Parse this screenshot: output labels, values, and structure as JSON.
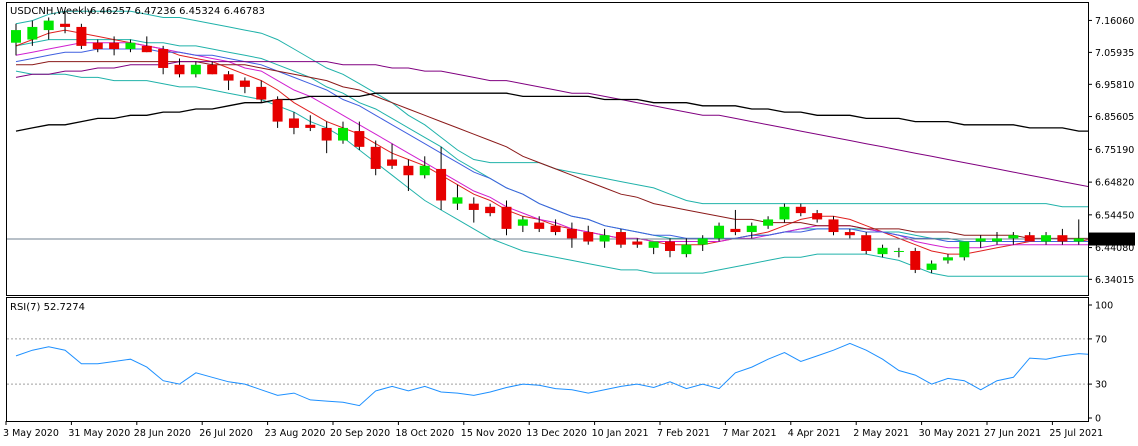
{
  "colors": {
    "background": "#ffffff",
    "frame": "#000000",
    "bull": "#00e600",
    "bear": "#e60000",
    "wick": "#000000",
    "bollinger": "#20b2aa",
    "ma_fast": "#e0201f",
    "ma_magenta": "#d020d0",
    "ma_blue": "#4060e0",
    "ma_dark_red": "#8b1a1a",
    "ma_purple": "#800080",
    "ma_black": "#000000",
    "rsi": "#1e90ff",
    "price_line": "#708090",
    "price_tag_bg": "#000000",
    "price_tag_fg": "#ffffff",
    "level_line": "#a0a0a0"
  },
  "chart_data": {
    "type": "candlestick",
    "title": "USDCNH,Weekly",
    "ohlc_header": "6.46257 6.47236 6.45324 6.46783",
    "last_price_label": "6.46783",
    "last_price": 6.46783,
    "ylim": [
      6.3,
      7.2
    ],
    "y_ticks": [
      "7.16060",
      "7.05935",
      "6.95810",
      "6.85605",
      "6.75190",
      "6.64820",
      "6.54450",
      "6.44080",
      "6.34015"
    ],
    "y_tick_values": [
      7.1606,
      7.05935,
      6.9581,
      6.85605,
      6.7519,
      6.6482,
      6.5445,
      6.4408,
      6.34015
    ],
    "x_labels": [
      "3 May 2020",
      "31 May 2020",
      "28 Jun 2020",
      "26 Jul 2020",
      "23 Aug 2020",
      "20 Sep 2020",
      "18 Oct 2020",
      "15 Nov 2020",
      "13 Dec 2020",
      "10 Jan 2021",
      "7 Feb 2021",
      "7 Mar 2021",
      "4 Apr 2021",
      "2 May 2021",
      "30 May 2021",
      "27 Jun 2021",
      "25 Jul 2021"
    ],
    "x_label_weeks": [
      0,
      4,
      8,
      12,
      16,
      20,
      24,
      28,
      32,
      36,
      40,
      44,
      48,
      52,
      56,
      60,
      64
    ],
    "candles": [
      {
        "o": 7.09,
        "h": 7.15,
        "l": 7.05,
        "c": 7.13
      },
      {
        "o": 7.1,
        "h": 7.16,
        "l": 7.08,
        "c": 7.14
      },
      {
        "o": 7.13,
        "h": 7.17,
        "l": 7.1,
        "c": 7.16
      },
      {
        "o": 7.15,
        "h": 7.19,
        "l": 7.12,
        "c": 7.14
      },
      {
        "o": 7.14,
        "h": 7.15,
        "l": 7.07,
        "c": 7.08
      },
      {
        "o": 7.09,
        "h": 7.1,
        "l": 7.06,
        "c": 7.07
      },
      {
        "o": 7.09,
        "h": 7.11,
        "l": 7.05,
        "c": 7.07
      },
      {
        "o": 7.07,
        "h": 7.1,
        "l": 7.06,
        "c": 7.09
      },
      {
        "o": 7.08,
        "h": 7.11,
        "l": 7.06,
        "c": 7.06
      },
      {
        "o": 7.07,
        "h": 7.08,
        "l": 6.99,
        "c": 7.01
      },
      {
        "o": 7.02,
        "h": 7.04,
        "l": 6.98,
        "c": 6.99
      },
      {
        "o": 6.99,
        "h": 7.03,
        "l": 6.98,
        "c": 7.02
      },
      {
        "o": 7.02,
        "h": 7.03,
        "l": 6.99,
        "c": 6.99
      },
      {
        "o": 6.99,
        "h": 7.0,
        "l": 6.94,
        "c": 6.97
      },
      {
        "o": 6.97,
        "h": 6.98,
        "l": 6.93,
        "c": 6.95
      },
      {
        "o": 6.95,
        "h": 6.97,
        "l": 6.9,
        "c": 6.91
      },
      {
        "o": 6.91,
        "h": 6.92,
        "l": 6.82,
        "c": 6.84
      },
      {
        "o": 6.85,
        "h": 6.87,
        "l": 6.8,
        "c": 6.82
      },
      {
        "o": 6.83,
        "h": 6.86,
        "l": 6.81,
        "c": 6.82
      },
      {
        "o": 6.82,
        "h": 6.84,
        "l": 6.74,
        "c": 6.78
      },
      {
        "o": 6.78,
        "h": 6.84,
        "l": 6.77,
        "c": 6.82
      },
      {
        "o": 6.81,
        "h": 6.84,
        "l": 6.75,
        "c": 6.76
      },
      {
        "o": 6.76,
        "h": 6.78,
        "l": 6.67,
        "c": 6.69
      },
      {
        "o": 6.72,
        "h": 6.77,
        "l": 6.69,
        "c": 6.7
      },
      {
        "o": 6.7,
        "h": 6.72,
        "l": 6.62,
        "c": 6.67
      },
      {
        "o": 6.67,
        "h": 6.73,
        "l": 6.66,
        "c": 6.7
      },
      {
        "o": 6.69,
        "h": 6.76,
        "l": 6.56,
        "c": 6.59
      },
      {
        "o": 6.58,
        "h": 6.64,
        "l": 6.56,
        "c": 6.6
      },
      {
        "o": 6.58,
        "h": 6.6,
        "l": 6.52,
        "c": 6.56
      },
      {
        "o": 6.57,
        "h": 6.58,
        "l": 6.54,
        "c": 6.55
      },
      {
        "o": 6.57,
        "h": 6.59,
        "l": 6.48,
        "c": 6.5
      },
      {
        "o": 6.51,
        "h": 6.54,
        "l": 6.49,
        "c": 6.53
      },
      {
        "o": 6.52,
        "h": 6.54,
        "l": 6.49,
        "c": 6.5
      },
      {
        "o": 6.51,
        "h": 6.53,
        "l": 6.48,
        "c": 6.49
      },
      {
        "o": 6.5,
        "h": 6.52,
        "l": 6.44,
        "c": 6.47
      },
      {
        "o": 6.49,
        "h": 6.51,
        "l": 6.45,
        "c": 6.46
      },
      {
        "o": 6.46,
        "h": 6.5,
        "l": 6.44,
        "c": 6.48
      },
      {
        "o": 6.49,
        "h": 6.5,
        "l": 6.44,
        "c": 6.45
      },
      {
        "o": 6.46,
        "h": 6.47,
        "l": 6.44,
        "c": 6.45
      },
      {
        "o": 6.44,
        "h": 6.46,
        "l": 6.42,
        "c": 6.46
      },
      {
        "o": 6.46,
        "h": 6.47,
        "l": 6.41,
        "c": 6.43
      },
      {
        "o": 6.42,
        "h": 6.47,
        "l": 6.41,
        "c": 6.45
      },
      {
        "o": 6.45,
        "h": 6.48,
        "l": 6.43,
        "c": 6.47
      },
      {
        "o": 6.47,
        "h": 6.52,
        "l": 6.46,
        "c": 6.51
      },
      {
        "o": 6.5,
        "h": 6.56,
        "l": 6.48,
        "c": 6.49
      },
      {
        "o": 6.49,
        "h": 6.52,
        "l": 6.47,
        "c": 6.51
      },
      {
        "o": 6.51,
        "h": 6.54,
        "l": 6.5,
        "c": 6.53
      },
      {
        "o": 6.53,
        "h": 6.58,
        "l": 6.52,
        "c": 6.57
      },
      {
        "o": 6.57,
        "h": 6.58,
        "l": 6.54,
        "c": 6.55
      },
      {
        "o": 6.55,
        "h": 6.56,
        "l": 6.52,
        "c": 6.53
      },
      {
        "o": 6.53,
        "h": 6.54,
        "l": 6.48,
        "c": 6.49
      },
      {
        "o": 6.49,
        "h": 6.5,
        "l": 6.47,
        "c": 6.48
      },
      {
        "o": 6.48,
        "h": 6.49,
        "l": 6.42,
        "c": 6.43
      },
      {
        "o": 6.42,
        "h": 6.45,
        "l": 6.41,
        "c": 6.44
      },
      {
        "o": 6.43,
        "h": 6.44,
        "l": 6.41,
        "c": 6.43
      },
      {
        "o": 6.43,
        "h": 6.44,
        "l": 6.36,
        "c": 6.37
      },
      {
        "o": 6.37,
        "h": 6.4,
        "l": 6.36,
        "c": 6.39
      },
      {
        "o": 6.4,
        "h": 6.42,
        "l": 6.39,
        "c": 6.41
      },
      {
        "o": 6.41,
        "h": 6.46,
        "l": 6.4,
        "c": 6.46
      },
      {
        "o": 6.46,
        "h": 6.48,
        "l": 6.44,
        "c": 6.47
      },
      {
        "o": 6.46,
        "h": 6.49,
        "l": 6.45,
        "c": 6.47
      },
      {
        "o": 6.47,
        "h": 6.49,
        "l": 6.45,
        "c": 6.48
      },
      {
        "o": 6.48,
        "h": 6.49,
        "l": 6.46,
        "c": 6.46
      },
      {
        "o": 6.46,
        "h": 6.49,
        "l": 6.45,
        "c": 6.48
      },
      {
        "o": 6.48,
        "h": 6.5,
        "l": 6.45,
        "c": 6.46
      },
      {
        "o": 6.46,
        "h": 6.53,
        "l": 6.45,
        "c": 6.47
      },
      {
        "o": 6.46,
        "h": 6.47,
        "l": 6.45,
        "c": 6.47
      }
    ],
    "bollinger": {
      "upper": [
        7.15,
        7.16,
        7.18,
        7.19,
        7.19,
        7.19,
        7.19,
        7.19,
        7.18,
        7.17,
        7.17,
        7.16,
        7.15,
        7.14,
        7.13,
        7.12,
        7.1,
        7.07,
        7.04,
        7.01,
        6.99,
        6.96,
        6.93,
        6.9,
        6.86,
        6.83,
        6.79,
        6.75,
        6.72,
        6.71,
        6.71,
        6.71,
        6.71,
        6.69,
        6.68,
        6.67,
        6.66,
        6.65,
        6.64,
        6.63,
        6.61,
        6.59,
        6.58,
        6.58,
        6.58,
        6.58,
        6.58,
        6.58,
        6.58,
        6.58,
        6.58,
        6.58,
        6.58,
        6.58,
        6.58,
        6.58,
        6.58,
        6.58,
        6.58,
        6.58,
        6.58,
        6.58,
        6.58,
        6.58,
        6.57,
        6.57,
        6.57
      ],
      "middle": [
        7.08,
        7.09,
        7.1,
        7.1,
        7.1,
        7.1,
        7.1,
        7.1,
        7.09,
        7.09,
        7.08,
        7.08,
        7.07,
        7.06,
        7.05,
        7.04,
        7.02,
        7.0,
        6.98,
        6.95,
        6.93,
        6.9,
        6.88,
        6.85,
        6.82,
        6.79,
        6.76,
        6.72,
        6.69,
        6.66,
        6.63,
        6.61,
        6.58,
        6.56,
        6.54,
        6.53,
        6.51,
        6.5,
        6.49,
        6.48,
        6.47,
        6.47,
        6.47,
        6.47,
        6.47,
        6.48,
        6.48,
        6.49,
        6.5,
        6.5,
        6.5,
        6.5,
        6.5,
        6.49,
        6.49,
        6.48,
        6.47,
        6.47,
        6.46,
        6.46,
        6.46,
        6.46,
        6.46,
        6.46,
        6.46,
        6.46,
        6.46
      ],
      "lower": [
        7.0,
        6.99,
        6.99,
        6.99,
        6.98,
        6.98,
        6.97,
        6.97,
        6.97,
        6.96,
        6.95,
        6.95,
        6.94,
        6.93,
        6.92,
        6.91,
        6.89,
        6.87,
        6.84,
        6.82,
        6.79,
        6.75,
        6.71,
        6.67,
        6.63,
        6.59,
        6.56,
        6.53,
        6.5,
        6.47,
        6.45,
        6.43,
        6.42,
        6.41,
        6.4,
        6.39,
        6.38,
        6.37,
        6.37,
        6.36,
        6.36,
        6.36,
        6.36,
        6.37,
        6.38,
        6.39,
        6.4,
        6.41,
        6.41,
        6.42,
        6.42,
        6.42,
        6.42,
        6.41,
        6.4,
        6.38,
        6.36,
        6.35,
        6.35,
        6.35,
        6.35,
        6.35,
        6.35,
        6.35,
        6.35,
        6.35,
        6.35
      ]
    },
    "moving_averages": [
      {
        "color_key": "ma_fast",
        "values": [
          7.08,
          7.1,
          7.12,
          7.13,
          7.12,
          7.11,
          7.1,
          7.09,
          7.08,
          7.07,
          7.05,
          7.04,
          7.03,
          7.01,
          6.99,
          6.97,
          6.94,
          6.9,
          6.87,
          6.84,
          6.82,
          6.8,
          6.77,
          6.74,
          6.72,
          6.7,
          6.67,
          6.64,
          6.61,
          6.59,
          6.56,
          6.54,
          6.53,
          6.51,
          6.5,
          6.49,
          6.48,
          6.47,
          6.47,
          6.46,
          6.45,
          6.45,
          6.45,
          6.46,
          6.47,
          6.48,
          6.49,
          6.51,
          6.53,
          6.54,
          6.54,
          6.53,
          6.51,
          6.49,
          6.47,
          6.45,
          6.43,
          6.42,
          6.42,
          6.43,
          6.44,
          6.45,
          6.46,
          6.46,
          6.46,
          6.46,
          6.47
        ]
      },
      {
        "color_key": "ma_magenta",
        "values": [
          7.05,
          7.06,
          7.07,
          7.08,
          7.09,
          7.09,
          7.09,
          7.09,
          7.08,
          7.07,
          7.06,
          7.05,
          7.04,
          7.03,
          7.01,
          7.0,
          6.97,
          6.94,
          6.92,
          6.89,
          6.86,
          6.83,
          6.8,
          6.77,
          6.74,
          6.71,
          6.68,
          6.65,
          6.62,
          6.6,
          6.57,
          6.55,
          6.53,
          6.52,
          6.5,
          6.49,
          6.48,
          6.47,
          6.47,
          6.46,
          6.46,
          6.46,
          6.46,
          6.46,
          6.47,
          6.47,
          6.48,
          6.49,
          6.5,
          6.51,
          6.51,
          6.51,
          6.5,
          6.49,
          6.48,
          6.46,
          6.45,
          6.44,
          6.44,
          6.44,
          6.45,
          6.45,
          6.45,
          6.45,
          6.45,
          6.45,
          6.45
        ]
      },
      {
        "color_key": "ma_blue",
        "values": [
          7.03,
          7.04,
          7.05,
          7.06,
          7.06,
          7.07,
          7.07,
          7.07,
          7.07,
          7.06,
          7.06,
          7.05,
          7.05,
          7.04,
          7.03,
          7.02,
          7.0,
          6.98,
          6.96,
          6.94,
          6.91,
          6.89,
          6.86,
          6.83,
          6.8,
          6.77,
          6.74,
          6.71,
          6.68,
          6.66,
          6.63,
          6.61,
          6.58,
          6.56,
          6.54,
          6.53,
          6.51,
          6.5,
          6.49,
          6.48,
          6.48,
          6.47,
          6.47,
          6.47,
          6.47,
          6.48,
          6.48,
          6.49,
          6.49,
          6.5,
          6.5,
          6.5,
          6.49,
          6.49,
          6.48,
          6.47,
          6.47,
          6.46,
          6.46,
          6.46,
          6.46,
          6.46,
          6.46,
          6.46,
          6.46,
          6.46,
          6.46
        ]
      },
      {
        "color_key": "ma_dark_red",
        "values": [
          7.02,
          7.02,
          7.03,
          7.03,
          7.03,
          7.03,
          7.03,
          7.03,
          7.03,
          7.03,
          7.03,
          7.03,
          7.02,
          7.02,
          7.02,
          7.01,
          7.0,
          6.99,
          6.98,
          6.97,
          6.95,
          6.94,
          6.92,
          6.9,
          6.88,
          6.86,
          6.84,
          6.82,
          6.8,
          6.78,
          6.76,
          6.73,
          6.71,
          6.69,
          6.67,
          6.65,
          6.63,
          6.61,
          6.6,
          6.58,
          6.57,
          6.56,
          6.55,
          6.54,
          6.53,
          6.53,
          6.52,
          6.52,
          6.52,
          6.51,
          6.51,
          6.51,
          6.5,
          6.5,
          6.5,
          6.49,
          6.49,
          6.49,
          6.48,
          6.48,
          6.48,
          6.48,
          6.47,
          6.47,
          6.47,
          6.47,
          6.47
        ]
      },
      {
        "color_key": "ma_purple",
        "values": [
          6.98,
          6.99,
          6.99,
          7.0,
          7.0,
          7.01,
          7.01,
          7.02,
          7.02,
          7.02,
          7.03,
          7.03,
          7.03,
          7.03,
          7.03,
          7.03,
          7.03,
          7.03,
          7.03,
          7.03,
          7.02,
          7.02,
          7.02,
          7.01,
          7.01,
          7.0,
          7.0,
          6.99,
          6.98,
          6.97,
          6.97,
          6.96,
          6.95,
          6.94,
          6.93,
          6.93,
          6.92,
          6.91,
          6.9,
          6.89,
          6.88,
          6.87,
          6.86,
          6.86,
          6.85,
          6.84,
          6.83,
          6.82,
          6.81,
          6.8,
          6.79,
          6.78,
          6.77,
          6.76,
          6.75,
          6.74,
          6.73,
          6.72,
          6.71,
          6.7,
          6.69,
          6.68,
          6.67,
          6.66,
          6.65,
          6.64,
          6.63
        ]
      },
      {
        "color_key": "ma_black",
        "values": [
          6.81,
          6.82,
          6.83,
          6.83,
          6.84,
          6.85,
          6.85,
          6.86,
          6.86,
          6.87,
          6.87,
          6.88,
          6.88,
          6.89,
          6.9,
          6.9,
          6.91,
          6.91,
          6.92,
          6.92,
          6.92,
          6.92,
          6.93,
          6.93,
          6.93,
          6.93,
          6.93,
          6.93,
          6.93,
          6.93,
          6.93,
          6.92,
          6.92,
          6.92,
          6.92,
          6.92,
          6.91,
          6.91,
          6.91,
          6.9,
          6.9,
          6.9,
          6.89,
          6.89,
          6.89,
          6.88,
          6.88,
          6.87,
          6.87,
          6.86,
          6.86,
          6.86,
          6.85,
          6.85,
          6.85,
          6.84,
          6.84,
          6.84,
          6.83,
          6.83,
          6.83,
          6.83,
          6.82,
          6.82,
          6.82,
          6.81,
          6.81
        ]
      }
    ],
    "rsi": {
      "label": "RSI(7) 52.7274",
      "period": 7,
      "value": 52.7274,
      "ylim": [
        0,
        100
      ],
      "levels": [
        70,
        30
      ],
      "ticks": [
        "100",
        "70",
        "30",
        "0"
      ],
      "tick_values": [
        100,
        70,
        30,
        0
      ],
      "values": [
        55,
        60,
        63,
        60,
        48,
        48,
        50,
        52,
        45,
        33,
        30,
        40,
        36,
        32,
        30,
        25,
        20,
        22,
        16,
        15,
        14,
        11,
        24,
        28,
        24,
        28,
        23,
        22,
        20,
        23,
        27,
        30,
        29,
        26,
        25,
        22,
        25,
        28,
        30,
        27,
        32,
        26,
        30,
        26,
        40,
        45,
        52,
        58,
        50,
        55,
        60,
        66,
        60,
        52,
        42,
        38,
        30,
        35,
        33,
        25,
        33,
        36,
        53,
        52,
        55,
        57,
        56,
        56,
        55,
        50,
        51
      ]
    }
  }
}
